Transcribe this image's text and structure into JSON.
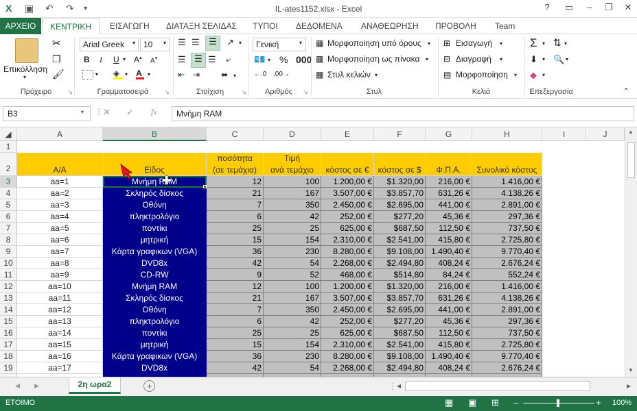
{
  "title": "IL-ates1152.xlsx - Excel",
  "tabs": [
    "ΑΡΧΕΙΟ",
    "ΚΕΝΤΡΙΚΗ",
    "ΕΙΣΑΓΩΓΗ",
    "ΔΙΑΤΑΞΗ ΣΕΛΙΔΑΣ",
    "ΤΥΠΟΙ",
    "ΔΕΔΟΜΕΝΑ",
    "ΑΝΑΘΕΩΡΗΣΗ",
    "ΠΡΟΒΟΛΗ",
    "Team"
  ],
  "ribbon": {
    "paste": "Επικόλληση",
    "font_name": "Arial Greek",
    "font_size": "10",
    "number_format": "Γενική",
    "cond_format": "Μορφοποίηση υπό όρους",
    "format_table": "Μορφοποίηση ως πίνακα",
    "cell_styles": "Στυλ κελιών",
    "insert": "Εισαγωγή",
    "delete": "Διαγραφή",
    "format": "Μορφοποίηση",
    "groups": [
      "Πρόχειρο",
      "Γραμματοσειρά",
      "Στοίχιση",
      "Αριθμός",
      "Στυλ",
      "Κελιά",
      "Επεξεργασία"
    ]
  },
  "formula": {
    "namebox": "B3",
    "value": "Μνήμη RAM"
  },
  "columns": [
    "A",
    "B",
    "C",
    "D",
    "E",
    "F",
    "G",
    "H",
    "I",
    "J"
  ],
  "header_row": {
    "a": "Α/Α",
    "b": "Είδος",
    "c1": "ποσότητα",
    "c2": "(σε τεμάχια)",
    "d1": "Τιμή",
    "d2": "ανά τεμάχιο",
    "e": "κόστος σε €",
    "f": "κόστος σε $",
    "g": "Φ.Π.Α.",
    "h": "Συνολικό κόστος"
  },
  "rows": [
    [
      "aa=1",
      "Μνήμη RAM",
      "12",
      "100",
      "1.200,00 €",
      "$1.320,00",
      "216,00 €",
      "1.416,00 €"
    ],
    [
      "aa=2",
      "Σκληρός δίσκος",
      "21",
      "167",
      "3.507,00 €",
      "$3.857,70",
      "631,26 €",
      "4.138,26 €"
    ],
    [
      "aa=3",
      "Οθόνη",
      "7",
      "350",
      "2.450,00 €",
      "$2.695,00",
      "441,00 €",
      "2.891,00 €"
    ],
    [
      "aa=4",
      "πληκτρολόγιο",
      "6",
      "42",
      "252,00 €",
      "$277,20",
      "45,36 €",
      "297,36 €"
    ],
    [
      "aa=5",
      "ποντίκι",
      "25",
      "25",
      "625,00 €",
      "$687,50",
      "112,50 €",
      "737,50 €"
    ],
    [
      "aa=6",
      "μητρική",
      "15",
      "154",
      "2.310,00 €",
      "$2.541,00",
      "415,80 €",
      "2.725,80 €"
    ],
    [
      "aa=7",
      "Κάρτα γραφικων (VGA)",
      "36",
      "230",
      "8.280,00 €",
      "$9.108,00",
      "1.490,40 €",
      "9.770,40 €"
    ],
    [
      "aa=8",
      "DVD8x",
      "42",
      "54",
      "2.268,00 €",
      "$2.494,80",
      "408,24 €",
      "2.676,24 €"
    ],
    [
      "aa=9",
      "CD-RW",
      "9",
      "52",
      "468,00 €",
      "$514,80",
      "84,24 €",
      "552,24 €"
    ],
    [
      "aa=10",
      "Μνήμη RAM",
      "12",
      "100",
      "1.200,00 €",
      "$1.320,00",
      "216,00 €",
      "1.416,00 €"
    ],
    [
      "aa=11",
      "Σκληρός δίσκος",
      "21",
      "167",
      "3.507,00 €",
      "$3.857,70",
      "631,26 €",
      "4.138,26 €"
    ],
    [
      "aa=12",
      "Οθόνη",
      "7",
      "350",
      "2.450,00 €",
      "$2.695,00",
      "441,00 €",
      "2.891,00 €"
    ],
    [
      "aa=13",
      "πληκτρολόγιο",
      "6",
      "42",
      "252,00 €",
      "$277,20",
      "45,36 €",
      "297,36 €"
    ],
    [
      "aa=14",
      "ποντίκι",
      "25",
      "25",
      "625,00 €",
      "$687,50",
      "112,50 €",
      "737,50 €"
    ],
    [
      "aa=15",
      "μητρική",
      "15",
      "154",
      "2.310,00 €",
      "$2.541,00",
      "415,80 €",
      "2.725,80 €"
    ],
    [
      "aa=16",
      "Κάρτα γραφικων (VGA)",
      "36",
      "230",
      "8.280,00 €",
      "$9.108,00",
      "1.490,40 €",
      "9.770,40 €"
    ],
    [
      "aa=17",
      "DVD8x",
      "42",
      "54",
      "2.268,00 €",
      "$2.494,80",
      "408,24 €",
      "2.676,24 €"
    ]
  ],
  "sheet_tab": "2η ωρα2",
  "status": {
    "ready": "ΕΤΟΙΜΟ",
    "zoom": "100%"
  },
  "colors": {
    "accent": "#217346",
    "selection_fill": "#00008b",
    "header_fill": "#ffcc00",
    "number_fill": "#c0c0c0"
  }
}
